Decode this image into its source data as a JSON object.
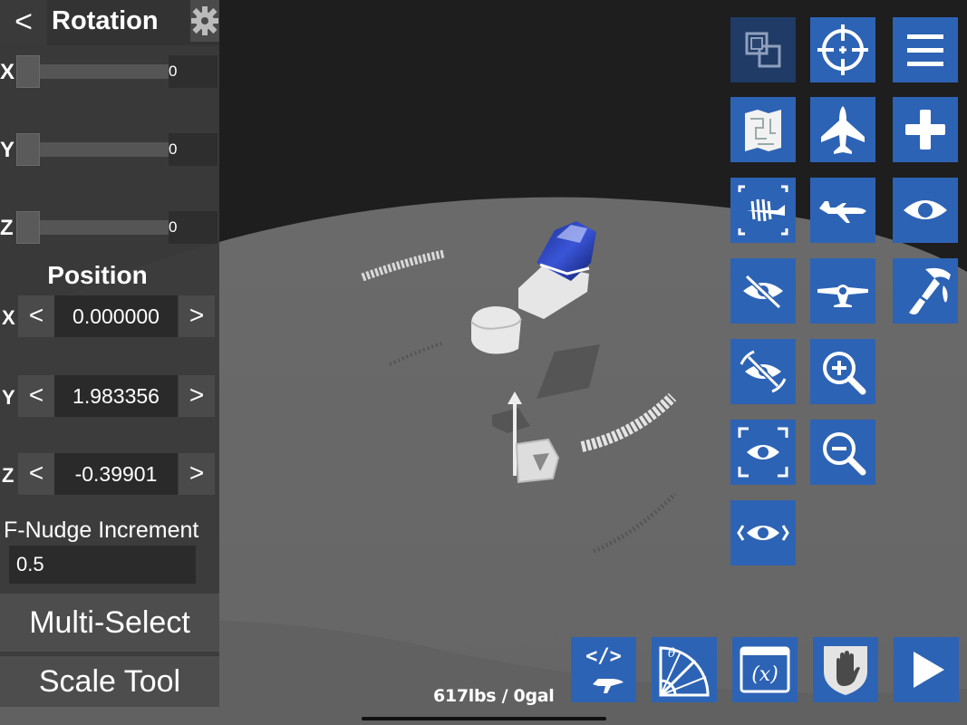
{
  "rotation_panel": {
    "title": "Rotation",
    "back_label": "<",
    "axes": [
      {
        "axis": "X",
        "value": "0",
        "level": 0
      },
      {
        "axis": "Y",
        "value": "0",
        "level": 0
      },
      {
        "axis": "Z",
        "value": "0",
        "level": 0
      }
    ]
  },
  "position_panel": {
    "title": "Position",
    "dec_label": "<",
    "inc_label": ">",
    "axes": [
      {
        "axis": "X",
        "value": "0.000000"
      },
      {
        "axis": "Y",
        "value": "1.983356"
      },
      {
        "axis": "Z",
        "value": "-0.39901"
      }
    ]
  },
  "nudge": {
    "label": "F-Nudge Increment",
    "value": "0.5"
  },
  "buttons": {
    "multi_select": "Multi-Select",
    "scale_tool": "Scale Tool"
  },
  "toolbar": {
    "accent": "#2d63b4",
    "icons": [
      "symmetry-icon",
      "center-target-icon",
      "menu-icon",
      "blueprint-icon",
      "aircraft-icon",
      "add-part-icon",
      "xray-fishbone-icon",
      "plane-side-icon",
      "eye-icon",
      "hide-icon",
      "plane-front-icon",
      "paint-icon",
      "hide-rotate-icon",
      "zoom-in-icon",
      "focus-eye-icon",
      "zoom-out-icon",
      "view-eye-icon"
    ],
    "bottom_icons": [
      "code-plane-icon",
      "angle-protractor-icon",
      "variables-icon",
      "hand-shield-icon",
      "play-icon"
    ],
    "bottom_variables_label": "(x)"
  },
  "status": {
    "weight_fuel": "617lbs / 0gal"
  }
}
